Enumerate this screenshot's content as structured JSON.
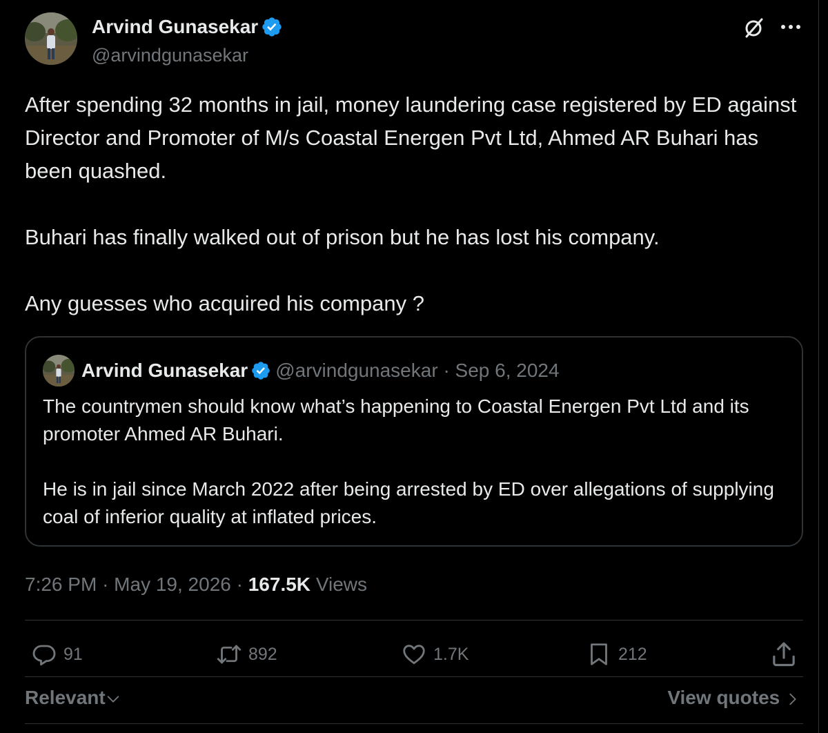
{
  "author": {
    "name": "Arvind Gunasekar",
    "handle": "@arvindgunasekar",
    "verified": true
  },
  "tweet": {
    "paragraphs": [
      "After spending 32 months in jail, money laundering case registered by ED against Director and Promoter of M/s Coastal Energen Pvt Ltd, Ahmed AR Buhari has been quashed.",
      "Buhari has finally walked out of prison but he has lost his company.",
      "Any guesses who acquired his company ?"
    ]
  },
  "quote": {
    "name": "Arvind Gunasekar",
    "handle": "@arvindgunasekar",
    "separator": "·",
    "date": "Sep 6, 2024",
    "paragraphs": [
      "The countrymen should know what’s happening to Coastal Energen Pvt Ltd and its promoter Ahmed AR Buhari.",
      "He is in jail since March 2022 after being arrested by ED over allegations of supplying coal of inferior quality at inflated prices."
    ]
  },
  "meta": {
    "time": "7:26 PM",
    "separator": "·",
    "date": "May 19, 2026",
    "views_count": "167.5K",
    "views_label": "Views"
  },
  "actions": {
    "replies": "91",
    "reposts": "892",
    "likes": "1.7K",
    "bookmarks": "212"
  },
  "footer": {
    "sort_label": "Relevant",
    "view_quotes_label": "View quotes"
  },
  "icons": {
    "verified": "verified-badge-icon",
    "grok": "grok-icon",
    "more": "more-icon",
    "reply": "reply-icon",
    "repost": "repost-icon",
    "like": "heart-icon",
    "bookmark": "bookmark-icon",
    "share": "share-icon"
  },
  "colors": {
    "background": "#000000",
    "text": "#e7e9ea",
    "secondary": "#71767b",
    "border": "#2f3336",
    "verified": "#1d9bf0"
  }
}
